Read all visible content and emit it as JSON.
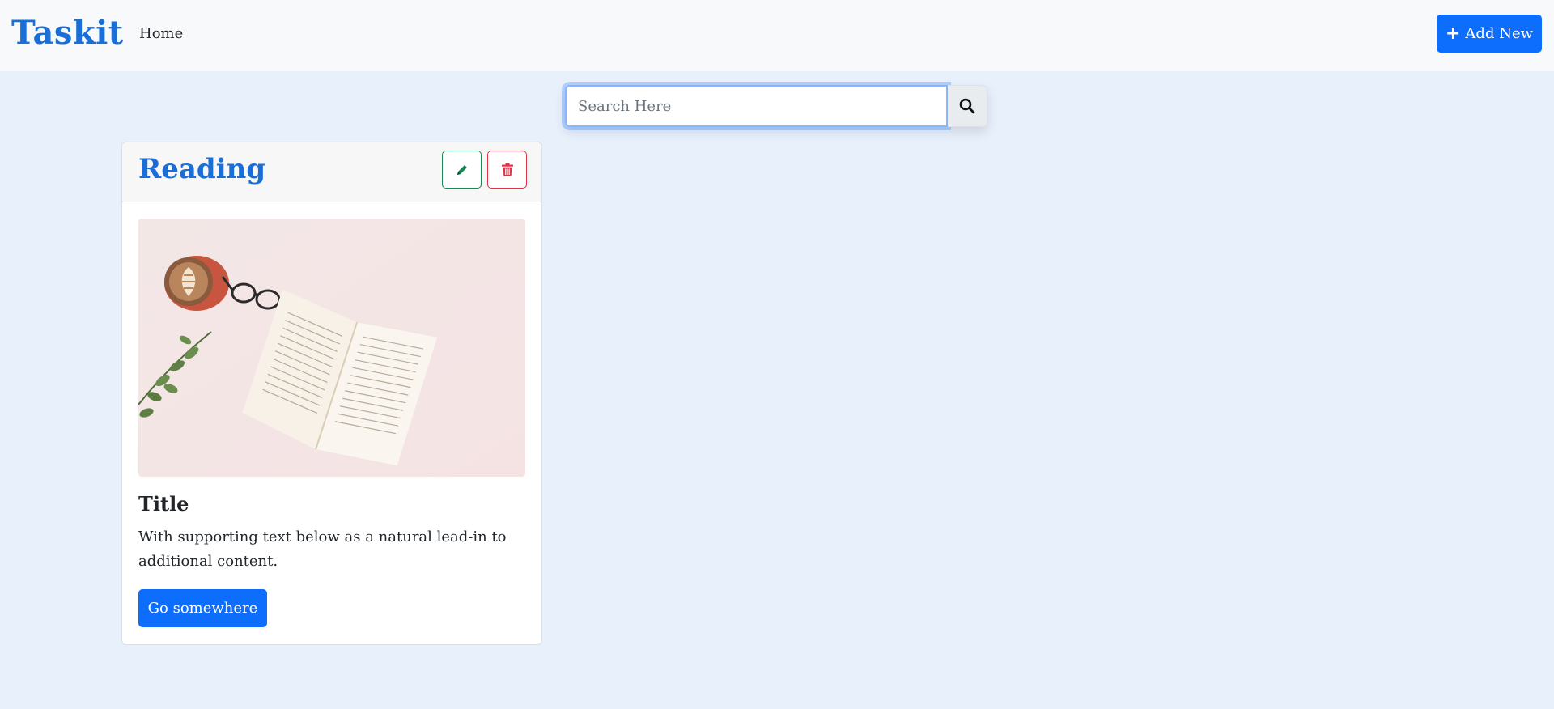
{
  "navbar": {
    "brand": "Taskit",
    "home_label": "Home",
    "add_button_label": "Add New",
    "brand_color": "#1a6ed8",
    "primary_color": "#0d6efd"
  },
  "search": {
    "placeholder": "Search Here",
    "value": "",
    "button_icon": "search-icon"
  },
  "cards": [
    {
      "category": "Reading",
      "edit_icon": "pencil-icon",
      "delete_icon": "trash-icon",
      "image": "book-coffee-glasses-flatlay",
      "title": "Title",
      "text": "With supporting text below as a natural lead-in to additional content.",
      "button_label": "Go somewhere"
    }
  ]
}
